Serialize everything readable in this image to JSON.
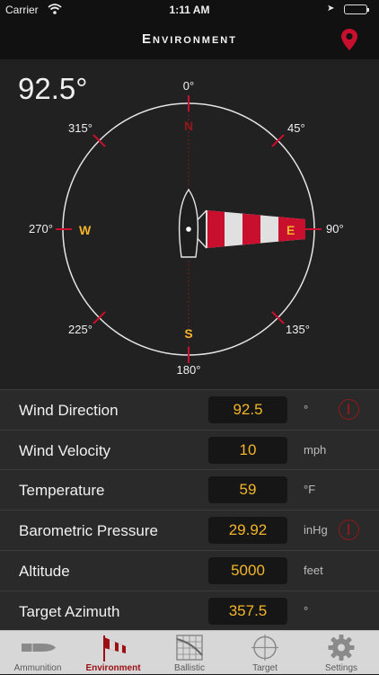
{
  "status": {
    "carrier": "Carrier",
    "time": "1:11 AM"
  },
  "nav": {
    "title": "Environment"
  },
  "compass": {
    "current_value": "92.5°",
    "degree_labels": [
      "0°",
      "45°",
      "90°",
      "135°",
      "180°",
      "225°",
      "270°",
      "315°"
    ],
    "cardinals": {
      "north": "N",
      "east": "E",
      "south": "S",
      "west": "W"
    },
    "wind_direction_deg": 92.5
  },
  "fields": [
    {
      "label": "Wind Direction",
      "value": "92.5",
      "unit": "°",
      "info": true
    },
    {
      "label": "Wind Velocity",
      "value": "10",
      "unit": "mph",
      "info": false
    },
    {
      "label": "Temperature",
      "value": "59",
      "unit": "°F",
      "info": false
    },
    {
      "label": "Barometric Pressure",
      "value": "29.92",
      "unit": "inHg",
      "info": true
    },
    {
      "label": "Altitude",
      "value": "5000",
      "unit": "feet",
      "info": false
    },
    {
      "label": "Target Azimuth",
      "value": "357.5",
      "unit": "°",
      "info": false
    }
  ],
  "tabs": [
    {
      "label": "Ammunition",
      "icon": "bullet-icon",
      "active": false
    },
    {
      "label": "Environment",
      "icon": "windsock-icon",
      "active": true
    },
    {
      "label": "Ballistic",
      "icon": "grid-chart-icon",
      "active": false
    },
    {
      "label": "Target",
      "icon": "crosshair-icon",
      "active": false
    },
    {
      "label": "Settings",
      "icon": "gear-icon",
      "active": false
    }
  ],
  "colors": {
    "accent_red": "#c8102e",
    "value_orange": "#f3b52a",
    "cardinal_orange": "#f3b52a"
  }
}
